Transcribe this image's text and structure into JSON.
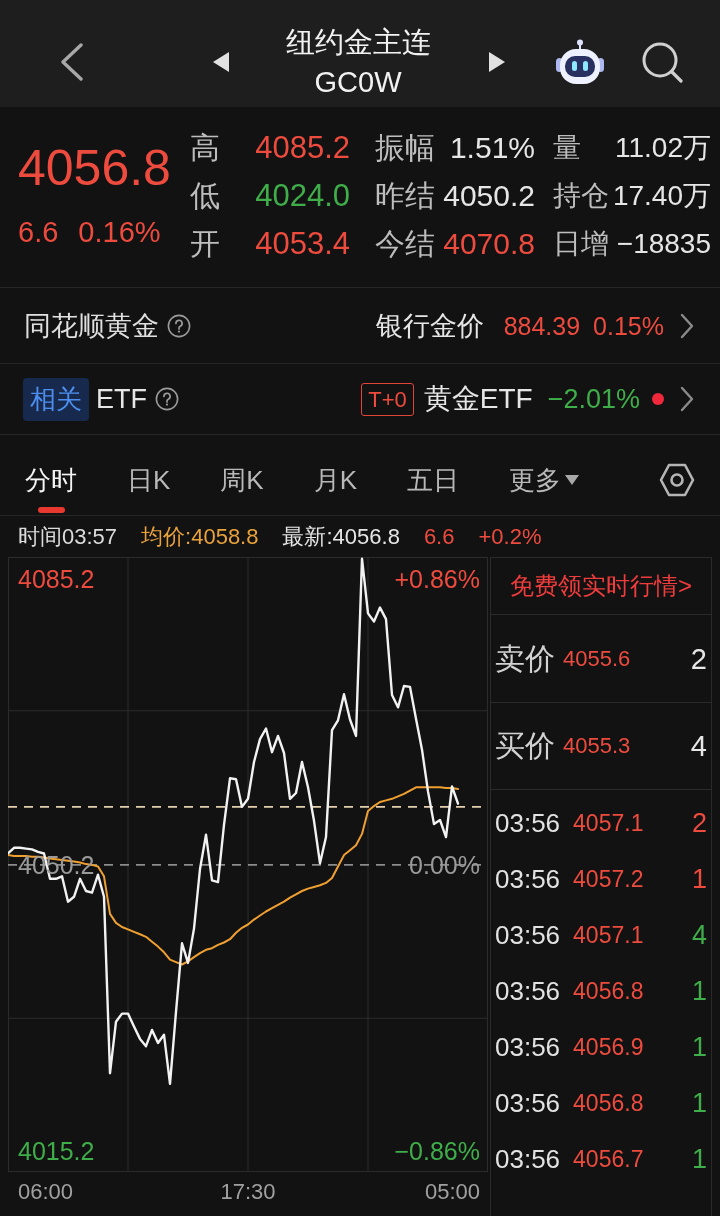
{
  "header": {
    "title": "纽约金主连",
    "code": "GC0W"
  },
  "quote": {
    "price": "4056.8",
    "change": "6.6",
    "change_percent": "0.16%"
  },
  "stats": [
    {
      "cells": [
        {
          "label": "高",
          "value": "4085.2",
          "color": "#ee4b3f"
        },
        {
          "label": "振幅",
          "value": "1.51%",
          "color": "#e6e6e6"
        },
        {
          "label": "量",
          "value": "11.02万",
          "color": "#e6e6e6"
        }
      ]
    },
    {
      "cells": [
        {
          "label": "低",
          "value": "4024.0",
          "color": "#3fae4a"
        },
        {
          "label": "昨结",
          "value": "4050.2",
          "color": "#e6e6e6"
        },
        {
          "label": "持仓",
          "value": "17.40万",
          "color": "#e6e6e6"
        }
      ]
    },
    {
      "cells": [
        {
          "label": "开",
          "value": "4053.4",
          "color": "#ee4b3f"
        },
        {
          "label": "今结",
          "value": "4070.8",
          "color": "#ee4b3f"
        },
        {
          "label": "日增",
          "value": "−18835",
          "color": "#e6e6e6"
        }
      ]
    }
  ],
  "gold_row": {
    "title": "同花顺黄金",
    "label": "银行金价",
    "price": "884.39",
    "change": "0.15%"
  },
  "etf_row": {
    "badge": "相关",
    "title": "ETF",
    "tag": "T+0",
    "label": "黄金ETF",
    "change": "−2.01%",
    "alert": true
  },
  "tabs": [
    {
      "label": "分时",
      "selected": true,
      "kind": "tab"
    },
    {
      "label": "日K",
      "selected": false,
      "kind": "tab"
    },
    {
      "label": "周K",
      "selected": false,
      "kind": "tab"
    },
    {
      "label": "月K",
      "selected": false,
      "kind": "tab"
    },
    {
      "label": "五日",
      "selected": false,
      "kind": "tab"
    },
    {
      "label": "更多",
      "selected": false,
      "kind": "menu"
    }
  ],
  "info_bar": {
    "time": "时间03:57",
    "average": "均价:4058.8",
    "latest": "最新:4056.8",
    "change": "6.6",
    "change_percent": "+0.2%"
  },
  "chart": {
    "chart_data": {
      "type": "line",
      "series": [
        {
          "color": "#f2f2f2",
          "values": [
            4051.6,
            4052.3,
            4052.3,
            4052.2,
            4052.1,
            4051.8,
            4051.6,
            4048.5,
            4048.5,
            4048.8,
            4045.7,
            4046.3,
            4048.5,
            4047.0,
            4046.8,
            4049.0,
            4046.3,
            4024.7,
            4031.0,
            4032.0,
            4032.0,
            4030.4,
            4028.9,
            4028.0,
            4030.0,
            4028.4,
            4029.4,
            4023.4,
            4032.2,
            4040.6,
            4038.2,
            4042.4,
            4049.7,
            4053.9,
            4048.3,
            4048.1,
            4055.1,
            4060.8,
            4060.7,
            4057.3,
            4058.3,
            4062.8,
            4065.6,
            4066.9,
            4064.0,
            4066.0,
            4063.9,
            4058.3,
            4059.0,
            4062.8,
            4059.7,
            4055.6,
            4050.4,
            4053.6,
            4066.7,
            4067.9,
            4071.1,
            4068.0,
            4066.0,
            4087.7,
            4081.0,
            4080.0,
            4081.7,
            4080.3,
            4071.0,
            4069.5,
            4072.1,
            4072.0,
            4068.1,
            4064.3,
            4059.2,
            4055.2,
            4055.7,
            4053.6,
            4059.8,
            4057.7,
            null,
            null,
            null,
            null,
            null
          ]
        },
        {
          "color": "#f0a030",
          "values": [
            4051.4,
            4051.3,
            4051.3,
            4051.3,
            4051.2,
            4051.2,
            4051.1,
            4051.0,
            4050.9,
            4050.8,
            4050.7,
            4050.6,
            4050.5,
            4050.3,
            4050.2,
            4050.0,
            4048.8,
            4044.2,
            4043.1,
            4042.6,
            4042.3,
            4042.0,
            4041.7,
            4041.4,
            4040.8,
            4040.2,
            4039.5,
            4038.6,
            4038.3,
            4038.0,
            4038.4,
            4038.9,
            4039.4,
            4039.8,
            4040.0,
            4040.4,
            4040.7,
            4041.1,
            4041.9,
            4042.5,
            4042.9,
            4043.5,
            4044.0,
            4044.5,
            4044.9,
            4045.3,
            4045.7,
            4046.2,
            4046.6,
            4047.0,
            4047.3,
            4047.5,
            4047.7,
            4048.0,
            4048.6,
            4050.0,
            4051.4,
            4052.0,
            4052.6,
            4054.0,
            4056.8,
            4057.4,
            4057.9,
            4058.1,
            4058.3,
            4058.6,
            4058.9,
            4059.3,
            4059.7,
            4059.7,
            4059.7,
            4059.7,
            4059.7,
            4059.6,
            4059.6,
            4059.5,
            null,
            null,
            null,
            null,
            null
          ]
        }
      ],
      "ylim": [
        4012.6,
        4087.9
      ],
      "yticks": [
        {
          "value": 4015.2,
          "label": "4015.2"
        },
        {
          "value": 4050.2,
          "label": "4050.2"
        },
        {
          "value": 4085.2,
          "label": "4085.2"
        }
      ],
      "grid": true,
      "ref_lines": [
        {
          "axis": "y",
          "value": 4050.2,
          "color": "#8c8c8c"
        },
        {
          "axis": "y",
          "value": 4057.3,
          "color": "#e3cfae"
        }
      ]
    },
    "percent_labels": [
      {
        "text": "+0.86%",
        "color": "#ee4b3f"
      },
      {
        "text": "0.00%",
        "color": "#9a9a9a"
      },
      {
        "text": "−0.86%",
        "color": "#3fae4a"
      }
    ],
    "time_labels": [
      "06:00",
      "17:30",
      "05:00"
    ]
  },
  "order_book": {
    "promo": "免费领实时行情>",
    "levels": [
      {
        "label": "卖价",
        "price": "4055.6",
        "volume": "2"
      },
      {
        "label": "买价",
        "price": "4055.3",
        "volume": "4"
      }
    ],
    "trades": [
      {
        "time": "03:56",
        "price": "4057.1",
        "volume": "2",
        "color": "#ee4b3f"
      },
      {
        "time": "03:56",
        "price": "4057.2",
        "volume": "1",
        "color": "#ee4b3f"
      },
      {
        "time": "03:56",
        "price": "4057.1",
        "volume": "4",
        "color": "#3fae4a"
      },
      {
        "time": "03:56",
        "price": "4056.8",
        "volume": "1",
        "color": "#3fae4a"
      },
      {
        "time": "03:56",
        "price": "4056.9",
        "volume": "1",
        "color": "#3fae4a"
      },
      {
        "time": "03:56",
        "price": "4056.8",
        "volume": "1",
        "color": "#3fae4a"
      },
      {
        "time": "03:56",
        "price": "4056.7",
        "volume": "1",
        "color": "#3fae4a"
      }
    ]
  }
}
